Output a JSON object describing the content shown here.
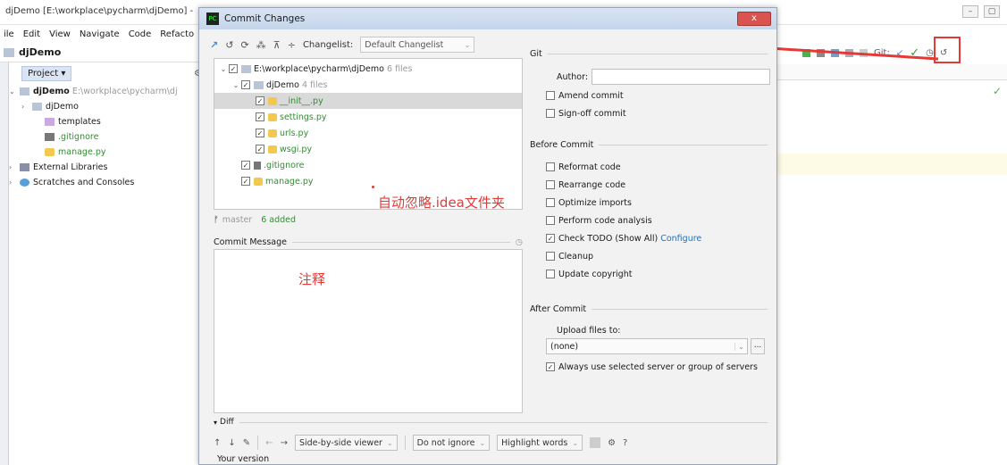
{
  "ide": {
    "window_title": "djDemo [E:\\workplace\\pycharm\\djDemo] -",
    "menu": [
      "ile",
      "Edit",
      "View",
      "Navigate",
      "Code",
      "Refacto"
    ],
    "project_name": "djDemo",
    "project_dropdown": "Project",
    "tree": [
      {
        "label": "djDemo",
        "extra": "E:\\workplace\\pycharm\\dj",
        "type": "folder"
      },
      {
        "label": "djDemo",
        "type": "folder"
      },
      {
        "label": "templates",
        "type": "folder"
      },
      {
        "label": ".gitignore",
        "type": "git"
      },
      {
        "label": "manage.py",
        "type": "py"
      },
      {
        "label": "External Libraries",
        "type": "lib"
      },
      {
        "label": "Scratches and Consoles",
        "type": "scratch"
      }
    ],
    "toolbar_git": "Git:"
  },
  "dialog": {
    "title": "Commit Changes",
    "close": "x",
    "changelist_label": "Changelist:",
    "changelist_value": "Default Changelist",
    "files": [
      {
        "label": "E:\\workplace\\pycharm\\djDemo",
        "count": "6 files",
        "level": 0
      },
      {
        "label": "djDemo",
        "count": "4 files",
        "level": 1
      },
      {
        "label": "__init__.py",
        "level": 2,
        "selected": true
      },
      {
        "label": "settings.py",
        "level": 2
      },
      {
        "label": "urls.py",
        "level": 2
      },
      {
        "label": "wsgi.py",
        "level": 2
      },
      {
        "label": ".gitignore",
        "level": 1
      },
      {
        "label": "manage.py",
        "level": 1
      }
    ],
    "annotation_ignore": "自动忽略.idea文件夹",
    "branch": "master",
    "added": "6 added",
    "commit_message_label": "Commit Message",
    "annotation_comment": "注释",
    "git_section": "Git",
    "author_label": "Author:",
    "author_value": "",
    "git_options": [
      {
        "label": "Amend commit",
        "checked": false
      },
      {
        "label": "Sign-off commit",
        "checked": false
      }
    ],
    "before_commit_section": "Before Commit",
    "before_options": [
      {
        "label": "Reformat code",
        "checked": false
      },
      {
        "label": "Rearrange code",
        "checked": false
      },
      {
        "label": "Optimize imports",
        "checked": false
      },
      {
        "label": "Perform code analysis",
        "checked": false
      },
      {
        "label": "Check TODO (Show All)",
        "checked": true,
        "link": "Configure"
      },
      {
        "label": "Cleanup",
        "checked": false
      },
      {
        "label": "Update copyright",
        "checked": false
      }
    ],
    "after_commit_section": "After Commit",
    "upload_label": "Upload files to:",
    "upload_value": "(none)",
    "always_use_label": "Always use selected server or group of servers",
    "diff_label": "Diff",
    "viewer": "Side-by-side viewer",
    "ignore": "Do not ignore",
    "highlight": "Highlight words",
    "help": "?",
    "your_version": "Your version"
  },
  "colors": {
    "accent": "#e53935",
    "link": "#2470b3",
    "added": "#2f8f2f"
  }
}
